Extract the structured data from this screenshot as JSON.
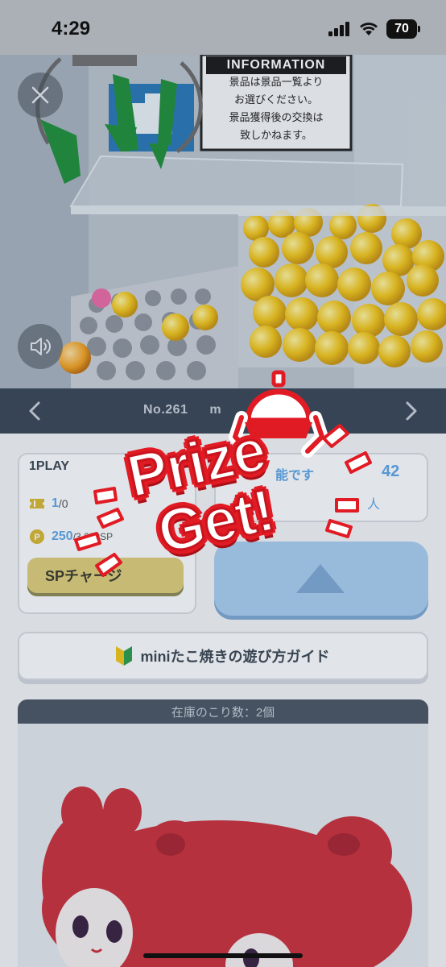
{
  "status_bar": {
    "time": "4:29",
    "battery": "70"
  },
  "video": {
    "info_title": "INFORMATION",
    "info_lines": [
      "景品は景品一覧より",
      "お選びください。",
      "景品獲得後の交換は",
      "致しかねます。"
    ]
  },
  "machine_nav": {
    "number": "No.261",
    "name_fragment": "m"
  },
  "play_panel": {
    "title": "1PLAY",
    "ticket_value": "1",
    "ticket_suffix": "/0",
    "points_value": "250",
    "points_suffix": "/3,680SP",
    "sp_button_label": "SPチャージ",
    "right_partial_text": "能です",
    "right_partial_count": "42",
    "right_partial_unit": "人"
  },
  "guide_button": {
    "label": "miniたこ焼きの遊び方ガイド"
  },
  "stock": {
    "header": "在庫のこり数：2個"
  },
  "prize_overlay": {
    "line1": "Prize",
    "line2": "Get!"
  },
  "colors": {
    "accent_red": "#e11b24",
    "nav_bg": "#3a4656",
    "link_blue": "#5ea6e6"
  }
}
